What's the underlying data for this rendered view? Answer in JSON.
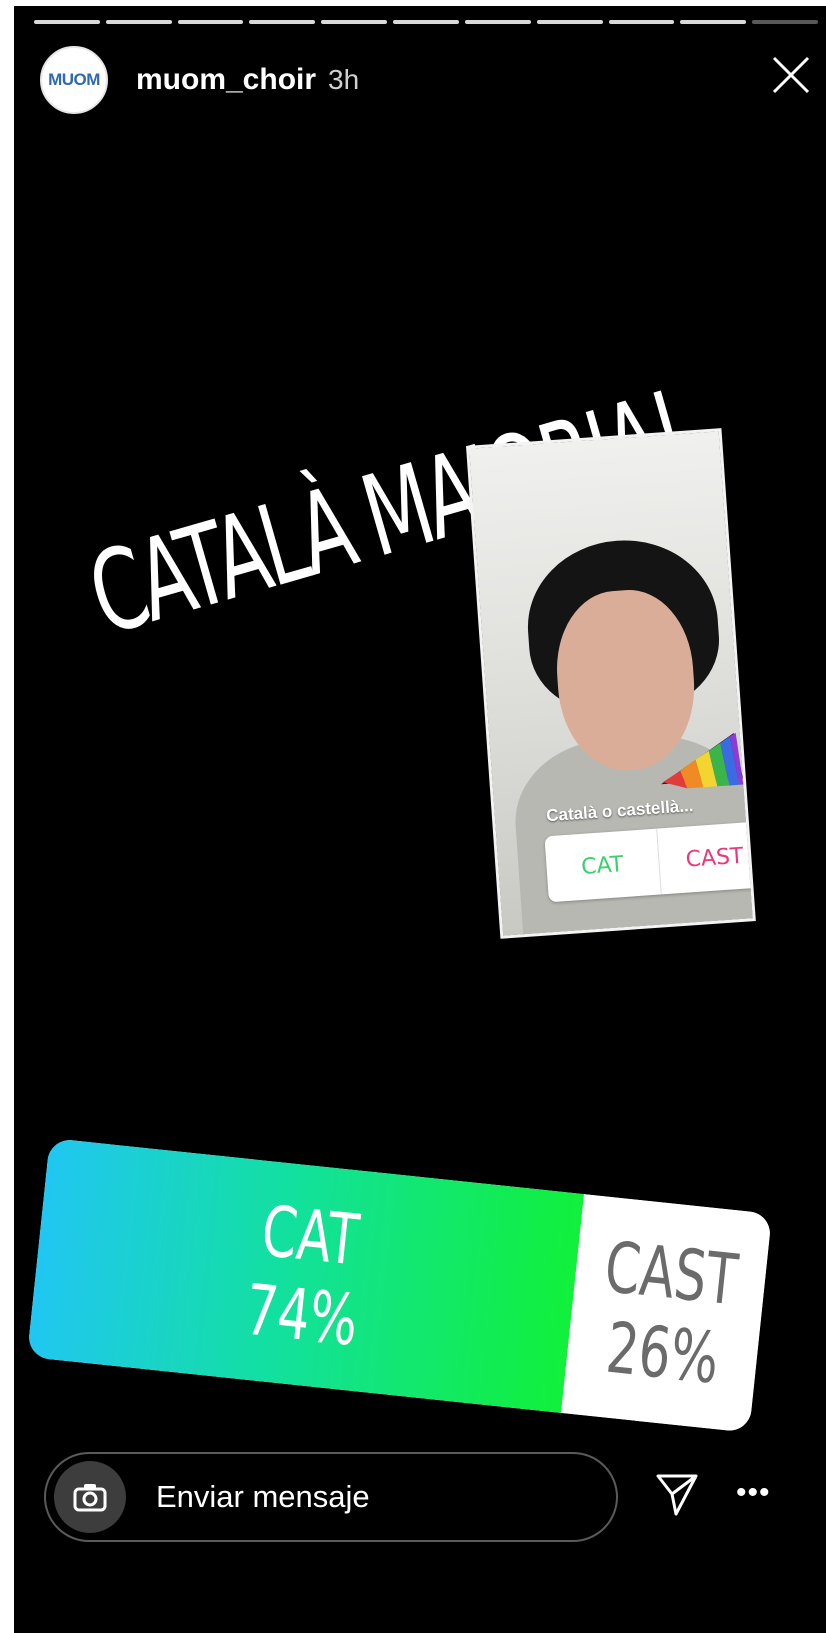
{
  "story": {
    "progress_segments": 11,
    "progress_active": 10,
    "username": "muom_choir",
    "timestamp": "3h",
    "avatar_text": "MUOM",
    "headline": "CATALÀ MAJORIA!"
  },
  "shared_story": {
    "caption": "Català o castellà...",
    "poll_option_1": "CAT",
    "poll_option_2": "CAST"
  },
  "poll_result": {
    "option_1_label": "CAT",
    "option_1_percent_text": "74%",
    "option_1_percent": 74,
    "option_2_label": "CAST",
    "option_2_percent_text": "26%",
    "option_2_percent": 26,
    "colors": {
      "gradient_start": "#21c6f2",
      "gradient_end": "#11f03a"
    }
  },
  "reply_bar": {
    "placeholder": "Enviar mensaje",
    "icons": [
      "camera-icon",
      "send-icon",
      "more-icon"
    ]
  }
}
